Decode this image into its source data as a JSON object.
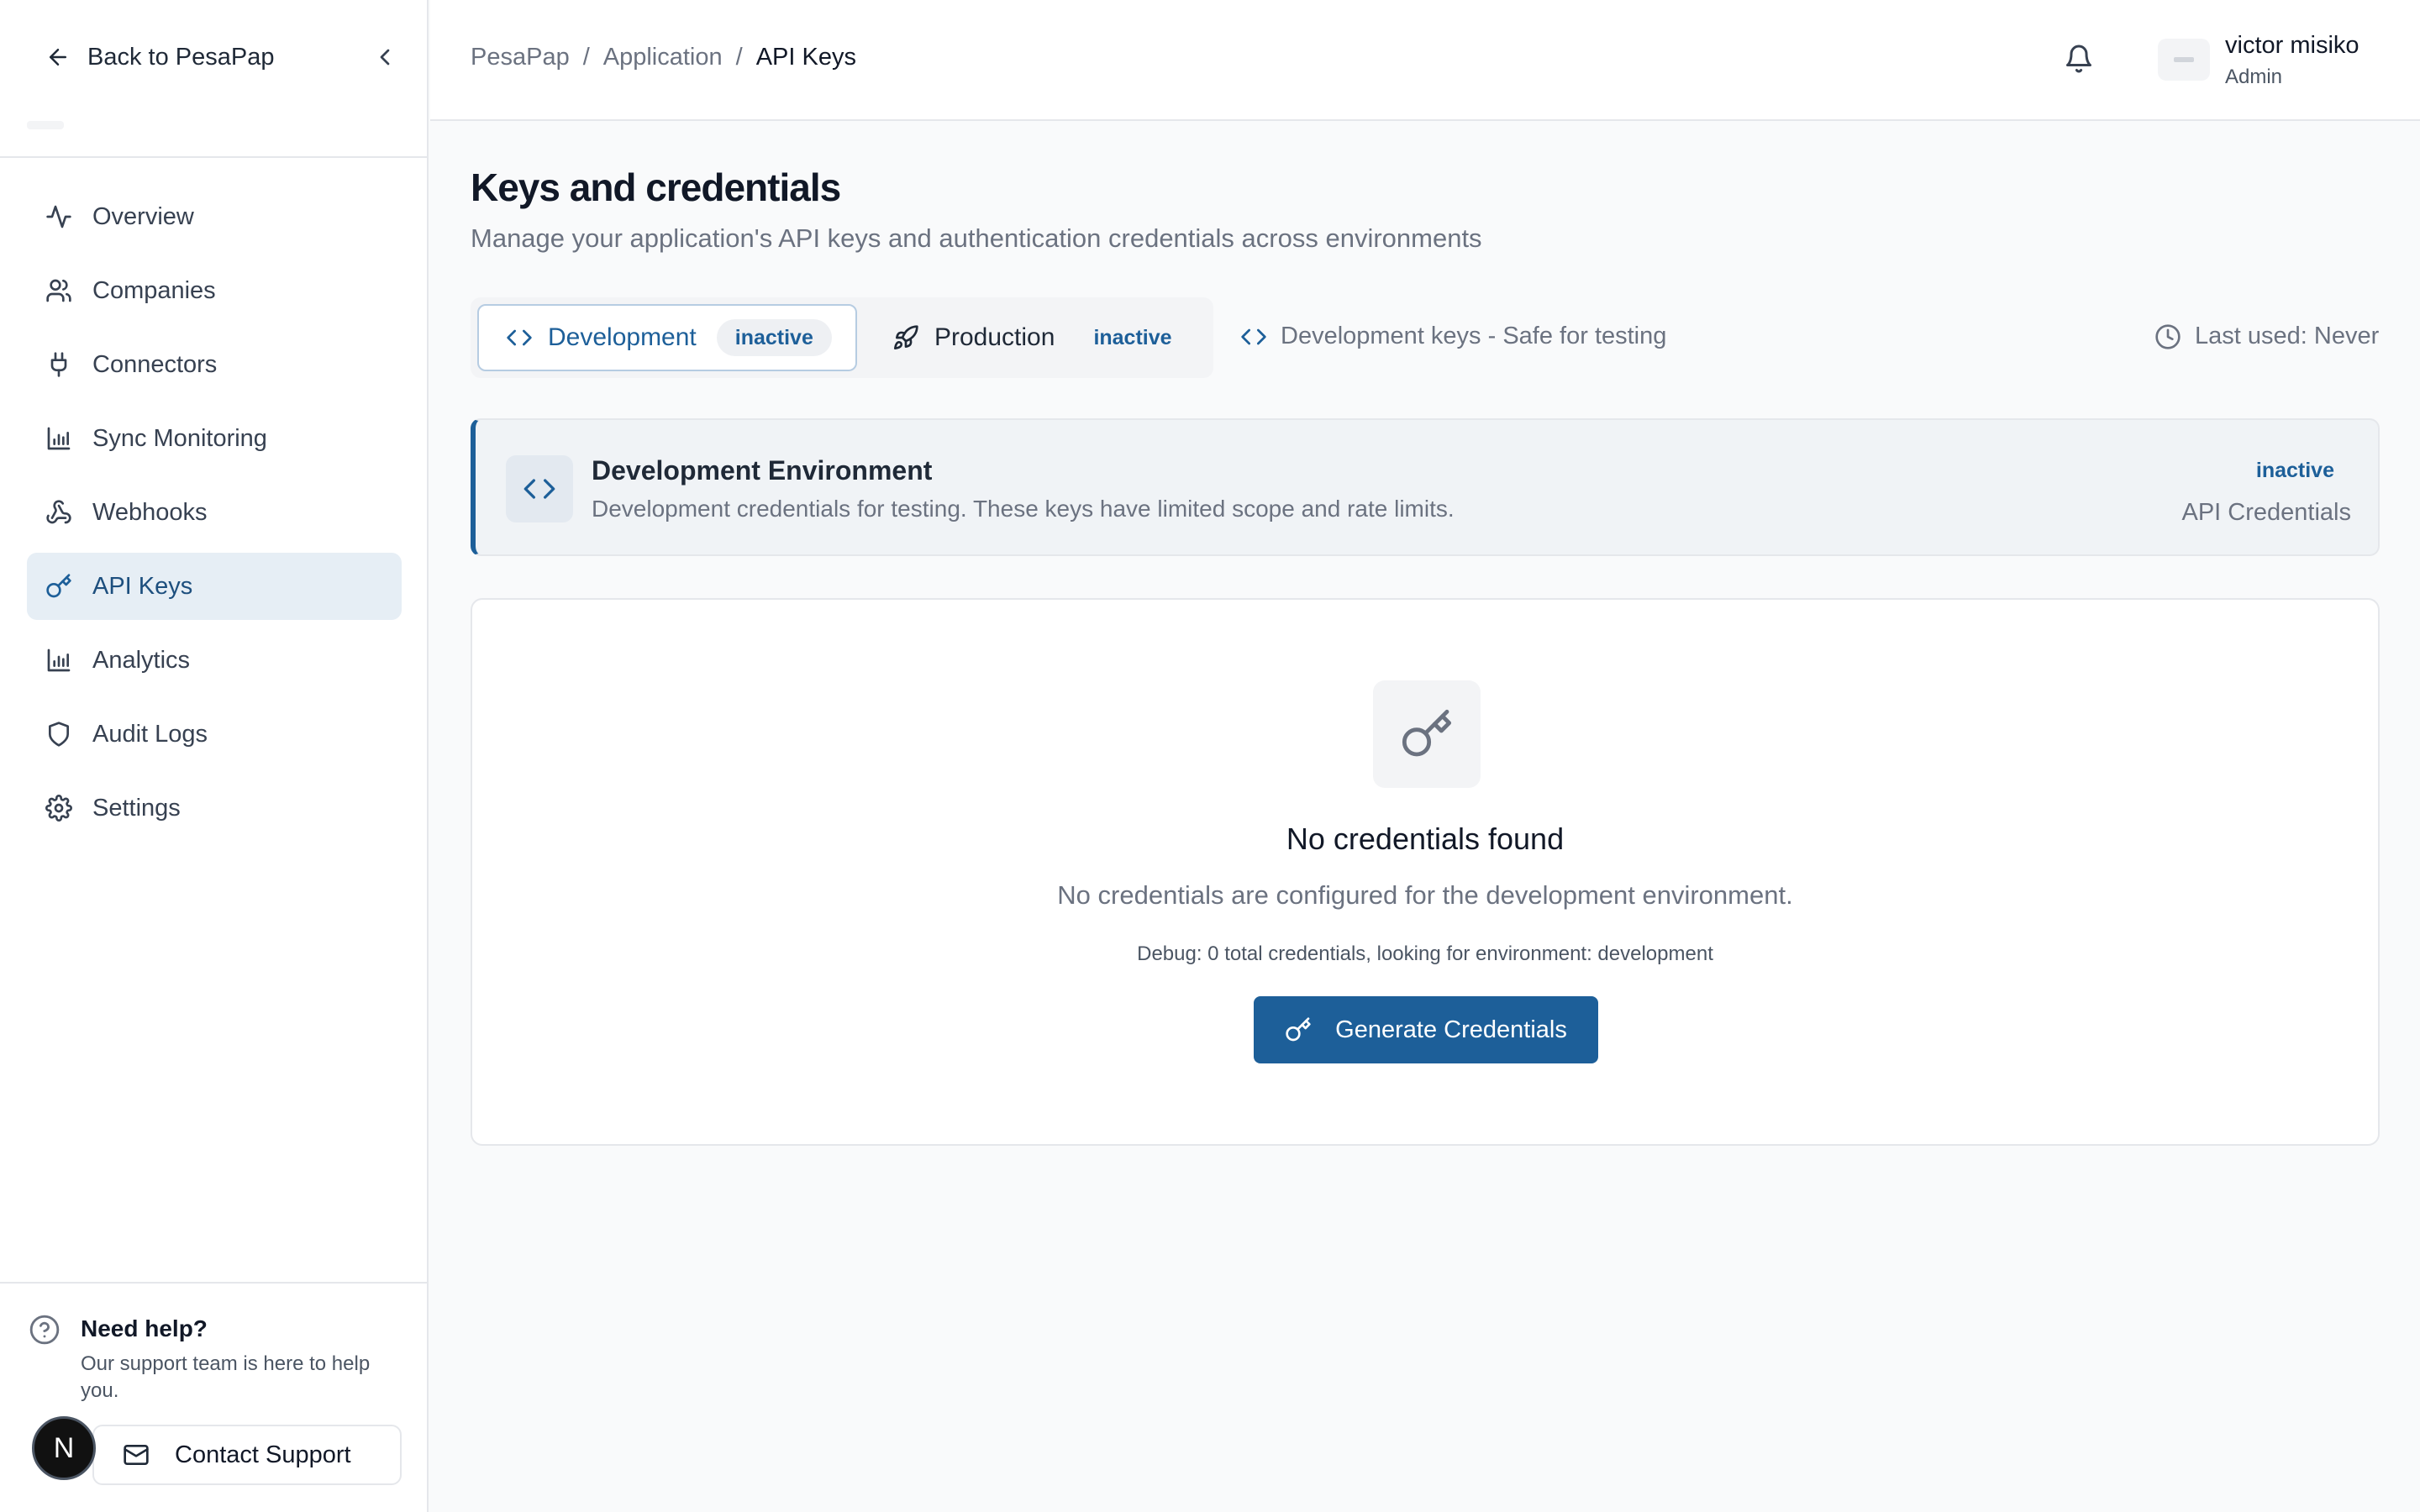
{
  "sidebar": {
    "back_label": "Back to PesaPap",
    "items": [
      {
        "label": "Overview",
        "icon": "activity-icon"
      },
      {
        "label": "Companies",
        "icon": "users-icon"
      },
      {
        "label": "Connectors",
        "icon": "plug-icon"
      },
      {
        "label": "Sync Monitoring",
        "icon": "bar-chart-icon"
      },
      {
        "label": "Webhooks",
        "icon": "webhook-icon"
      },
      {
        "label": "API Keys",
        "icon": "key-icon",
        "active": true
      },
      {
        "label": "Analytics",
        "icon": "bar-chart-icon"
      },
      {
        "label": "Audit Logs",
        "icon": "shield-icon"
      },
      {
        "label": "Settings",
        "icon": "gear-icon"
      }
    ],
    "help": {
      "title": "Need help?",
      "text": "Our support team is here to help you.",
      "contact_label": "Contact Support"
    },
    "badge_letter": "N"
  },
  "header": {
    "breadcrumb": [
      "PesaPap",
      "Application",
      "API Keys"
    ],
    "breadcrumb_separator": "/",
    "user": {
      "name": "victor misiko",
      "role": "Admin"
    }
  },
  "main": {
    "title": "Keys and credentials",
    "subtitle": "Manage your application's API keys and authentication credentials across environments",
    "tabs": [
      {
        "label": "Development",
        "badge": "inactive",
        "icon": "code-icon",
        "selected": true
      },
      {
        "label": "Production",
        "badge": "inactive",
        "icon": "rocket-icon",
        "selected": false
      }
    ],
    "env_hint": "Development keys - Safe for testing",
    "last_used": "Last used: Never",
    "env_card": {
      "title": "Development Environment",
      "description": "Development credentials for testing. These keys have limited scope and rate limits.",
      "status": "inactive",
      "kind": "API Credentials"
    },
    "empty_state": {
      "title": "No credentials found",
      "description": "No credentials are configured for the development environment.",
      "debug": "Debug: 0 total credentials, looking for environment: development",
      "button_label": "Generate Credentials"
    }
  },
  "colors": {
    "accent": "#1d5f99",
    "active_nav_bg": "#e6eef5",
    "page_bg": "#f9fafb",
    "muted_text": "#6b7280"
  }
}
